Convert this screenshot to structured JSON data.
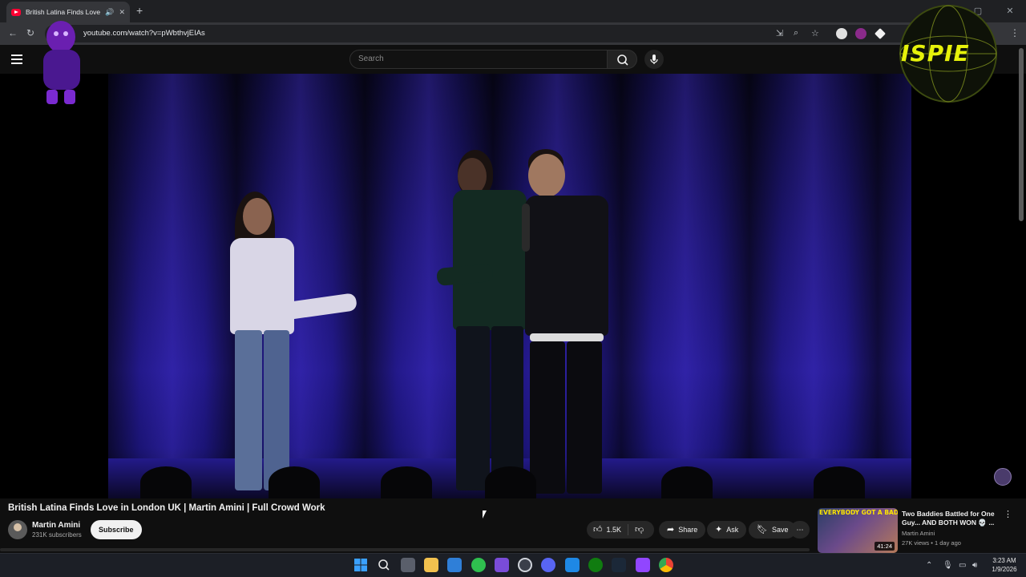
{
  "browser": {
    "tab_title": "British Latina Finds Love in",
    "new_tab_label": "+",
    "url": "youtube.com/watch?v=pWbthvjEIAs",
    "window_controls": [
      "—",
      "▢",
      "✕"
    ]
  },
  "youtube": {
    "search_placeholder": "Search",
    "video": {
      "title": "British Latina Finds Love in London UK | Martin Amini | Full Crowd Work",
      "channel_name": "Martin Amini",
      "subscribers": "231K subscribers",
      "subscribe_label": "Subscribe",
      "like_count": "1.5K",
      "share_label": "Share",
      "ask_label": "Ask",
      "save_label": "Save"
    },
    "recommendation": {
      "thumb_banner": "EVERYBODY GOT A BADDIE",
      "duration": "41:24",
      "title": "Two Baddies Battled for One Guy... AND BOTH WON 💀 ...",
      "channel": "Martin Amini",
      "meta": "27K views • 1 day ago"
    }
  },
  "overlay": {
    "right_sticker_text": "ISPIE"
  },
  "taskbar": {
    "time": "3:23 AM",
    "date": "1/9/2026"
  },
  "colors": {
    "youtube_red": "#ff0033",
    "background": "#0f0f0f",
    "stage_blue": "#241a8a"
  }
}
